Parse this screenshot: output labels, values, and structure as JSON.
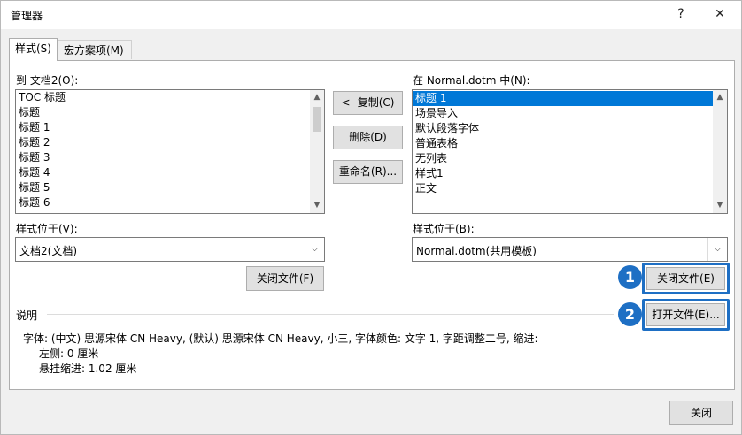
{
  "window": {
    "title": "管理器",
    "help_glyph": "?",
    "close_glyph": "✕"
  },
  "tabs": [
    {
      "label": "样式(S)",
      "active": true
    },
    {
      "label": "宏方案项(M)",
      "active": false
    }
  ],
  "left": {
    "list_label": "到 文档2(O):",
    "items": [
      "TOC 标题",
      "标题",
      "标题 1",
      "标题 2",
      "标题 3",
      "标题 4",
      "标题 5",
      "标题 6"
    ],
    "location_label": "样式位于(V):",
    "location_value": "文档2(文档)",
    "close_file_label": "关闭文件(F)"
  },
  "middle": {
    "copy_label": "<- 复制(C)",
    "delete_label": "删除(D)",
    "rename_label": "重命名(R)..."
  },
  "right": {
    "list_label": "在 Normal.dotm 中(N):",
    "items": [
      "标题 1",
      "场景导入",
      "默认段落字体",
      "普通表格",
      "无列表",
      "样式1",
      "正文"
    ],
    "selected_index": 0,
    "location_label": "样式位于(B):",
    "location_value": "Normal.dotm(共用模板)",
    "close_file_label": "关闭文件(E)",
    "open_file_label": "打开文件(E)..."
  },
  "description": {
    "label": "说明",
    "line1": "字体: (中文) 思源宋体 CN Heavy, (默认) 思源宋体 CN Heavy, 小三, 字体颜色: 文字 1, 字距调整二号, 缩进:",
    "line2": "左侧:  0 厘米",
    "line3": "悬挂缩进: 1.02 厘米"
  },
  "annotations": {
    "badge1": "1",
    "badge2": "2"
  },
  "footer": {
    "close_label": "关闭"
  },
  "colors": {
    "accent": "#1e6fc4",
    "selection": "#0078d7"
  }
}
